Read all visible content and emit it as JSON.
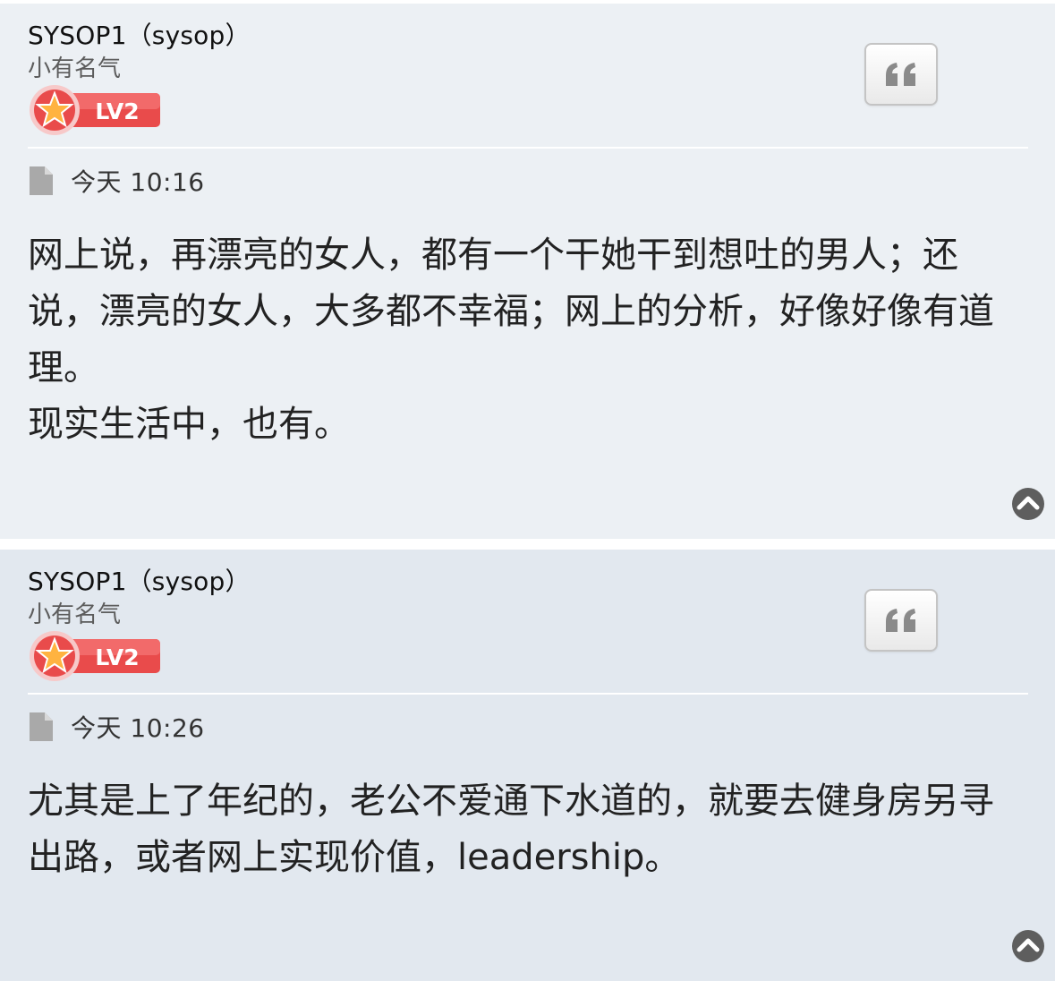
{
  "posts": [
    {
      "author": "SYSOP1（sysop）",
      "rank": "小有名气",
      "level_badge": "LV2",
      "time": "今天 10:16",
      "paragraphs": [
        "网上说，再漂亮的女人，都有一个干她干到想吐的男人；还说，漂亮的女人，大多都不幸福；网上的分析，好像好像有道理。",
        "现实生活中，也有。"
      ]
    },
    {
      "author": "SYSOP1（sysop）",
      "rank": "小有名气",
      "level_badge": "LV2",
      "time": "今天 10:26",
      "paragraphs": [
        "尤其是上了年纪的，老公不爱通下水道的，就要去健身房另寻出路，或者网上实现价值，leadership。"
      ]
    }
  ],
  "icons": {
    "quote": "quote-icon",
    "post_time": "page-icon",
    "back_to_top": "chevron-up-circle-icon"
  },
  "colors": {
    "post_bg_odd": "#ecf0f4",
    "post_bg_even": "#e2e8ef",
    "badge_red": "#e94b4b"
  }
}
